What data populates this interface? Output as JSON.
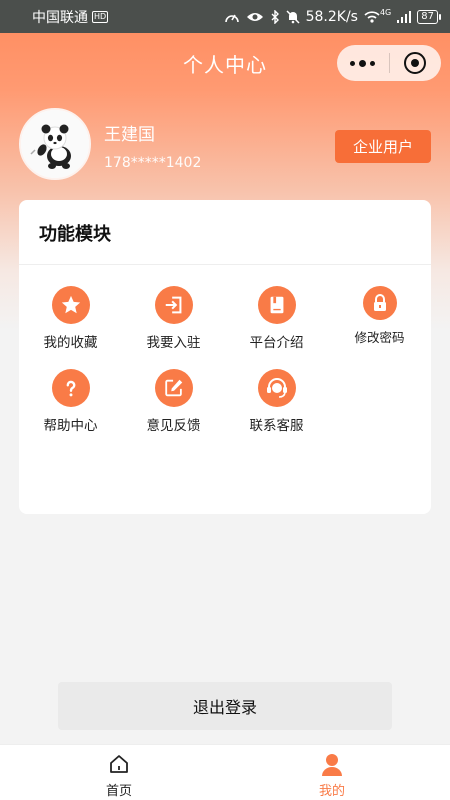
{
  "status_bar": {
    "carrier": "中国联通",
    "hd": "HD",
    "net_speed": "58.2K/s",
    "net_type": "4G",
    "battery": "87"
  },
  "header": {
    "title": "个人中心"
  },
  "profile": {
    "name": "王建国",
    "phone": "178*****1402",
    "badge": "企业用户"
  },
  "functions": {
    "title": "功能模块",
    "items": [
      {
        "label": "我的收藏",
        "icon": "star-icon"
      },
      {
        "label": "我要入驻",
        "icon": "sign-in-icon"
      },
      {
        "label": "平台介绍",
        "icon": "book-icon"
      },
      {
        "label": "修改密码",
        "icon": "lock-icon"
      },
      {
        "label": "帮助中心",
        "icon": "question-icon"
      },
      {
        "label": "意见反馈",
        "icon": "edit-icon"
      },
      {
        "label": "联系客服",
        "icon": "customer-service-icon"
      }
    ]
  },
  "logout_label": "退出登录",
  "tabbar": {
    "home": "首页",
    "mine": "我的"
  },
  "colors": {
    "accent": "#f97b47",
    "badge": "#f76e38",
    "header_top": "#ff8a5c"
  }
}
